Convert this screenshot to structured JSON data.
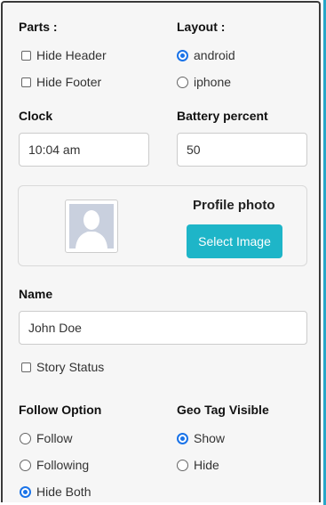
{
  "parts": {
    "heading": "Parts :",
    "hide_header": "Hide Header",
    "hide_footer": "Hide Footer"
  },
  "layout": {
    "heading": "Layout :",
    "options": [
      "android",
      "iphone"
    ],
    "selected": "android"
  },
  "clock": {
    "label": "Clock",
    "value": "10:04 am"
  },
  "battery": {
    "label": "Battery percent",
    "value": "50"
  },
  "profile": {
    "label": "Profile photo",
    "button": "Select Image"
  },
  "name": {
    "label": "Name",
    "value": "John Doe"
  },
  "story": {
    "label": "Story Status"
  },
  "follow": {
    "heading": "Follow Option",
    "options": [
      "Follow",
      "Following",
      "Hide Both"
    ],
    "selected": "Hide Both"
  },
  "geotag": {
    "heading": "Geo Tag Visible",
    "options": [
      "Show",
      "Hide"
    ],
    "selected": "Show"
  },
  "colors": {
    "accent": "#1eb5c8",
    "radio": "#1a73e8"
  }
}
